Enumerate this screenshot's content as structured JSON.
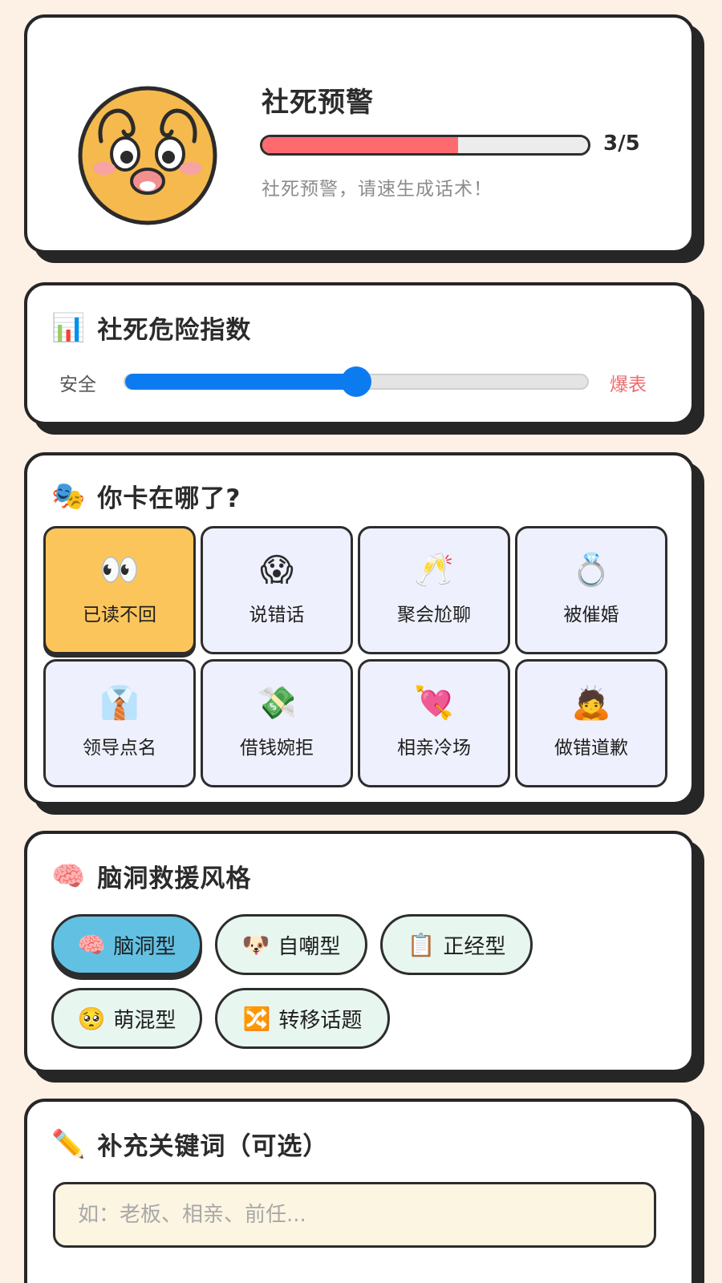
{
  "status": {
    "title": "社死预警",
    "progress_value": 3,
    "progress_max": 5,
    "progress_text": "3/5",
    "message": "社死预警，请速生成话术！",
    "fill_color": "#ff6a6f"
  },
  "meter": {
    "icon": "bar-chart-icon",
    "emoji": "📊",
    "title": "社死危险指数",
    "min_label": "安全",
    "max_label": "爆表",
    "level_fraction": 0.5,
    "accent": "#0d7bf0"
  },
  "scenarios": {
    "icon": "theater-masks-icon",
    "emoji": "🎭",
    "title": "你卡在哪了?",
    "selected_index": 0,
    "items": [
      {
        "emoji": "👀",
        "icon": "eyes-icon",
        "label": "已读不回"
      },
      {
        "emoji": "😱",
        "icon": "screaming-face-icon",
        "label": "说错话"
      },
      {
        "emoji": "🥂",
        "icon": "champagne-glasses-icon",
        "label": "聚会尬聊"
      },
      {
        "emoji": "💍",
        "icon": "ring-icon",
        "label": "被催婚"
      },
      {
        "emoji": "👔",
        "icon": "necktie-icon",
        "label": "领导点名"
      },
      {
        "emoji": "💸",
        "icon": "money-wings-icon",
        "label": "借钱婉拒"
      },
      {
        "emoji": "💘",
        "icon": "heart-arrow-icon",
        "label": "相亲冷场"
      },
      {
        "emoji": "🙇",
        "icon": "bowing-person-icon",
        "label": "做错道歉"
      }
    ]
  },
  "styles": {
    "icon": "brain-icon",
    "emoji": "🧠",
    "title": "脑洞救援风格",
    "active_index": 0,
    "items": [
      {
        "emoji": "🧠",
        "icon": "brain-icon",
        "label": "脑洞型"
      },
      {
        "emoji": "🐶",
        "icon": "dog-face-icon",
        "label": "自嘲型"
      },
      {
        "emoji": "📋",
        "icon": "clipboard-icon",
        "label": "正经型"
      },
      {
        "emoji": "🥺",
        "icon": "pleading-face-icon",
        "label": "萌混型"
      },
      {
        "emoji": "🔀",
        "icon": "shuffle-icon",
        "label": "转移话题"
      }
    ]
  },
  "keywords": {
    "icon": "pencil-icon",
    "emoji": "✏️",
    "title": "补充关键词（可选）",
    "placeholder": "如：老板、相亲、前任...",
    "value": ""
  }
}
